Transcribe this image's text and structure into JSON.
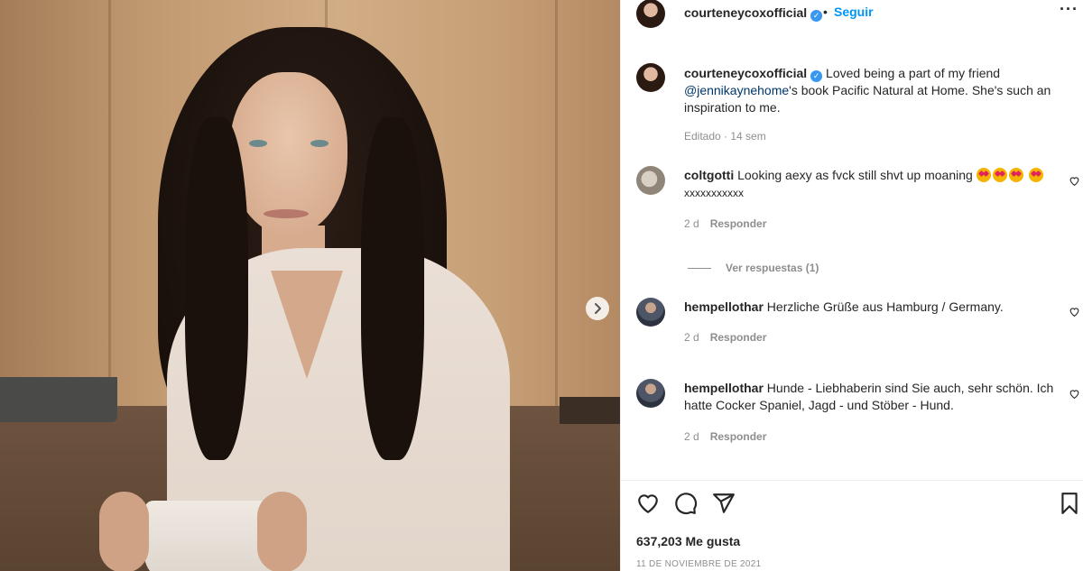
{
  "post": {
    "author": {
      "username": "courteneycoxofficial",
      "verified": true,
      "follow_label": "Seguir",
      "separator": "•"
    },
    "caption": {
      "username": "courteneycoxofficial",
      "text_before": "Loved being a part of my friend",
      "mention": "@jennikaynehome",
      "text_after": "'s book Pacific Natural at Home. She's such an inspiration to me.",
      "meta": "Editado · 14 sem"
    },
    "comments": [
      {
        "username": "coltgotti",
        "text": "Looking aexy as fvck still shvt up moaning",
        "text_tail": "xxxxxxxxxxx",
        "emojis": [
          "star-struck-emoji",
          "star-struck-emoji",
          "star-struck-emoji",
          "star-struck-emoji"
        ],
        "time": "2 d",
        "reply_label": "Responder",
        "view_replies": "Ver respuestas (1)"
      },
      {
        "username": "hempellothar",
        "text": "Herzliche Grüße aus Hamburg / Germany.",
        "time": "2 d",
        "reply_label": "Responder"
      },
      {
        "username": "hempellothar",
        "text": "Hunde - Liebhaberin sind Sie auch, sehr schön. Ich hatte Cocker Spaniel, Jagd - und Stöber - Hund.",
        "time": "2 d",
        "reply_label": "Responder"
      }
    ],
    "likes": "637,203 Me gusta",
    "date": "11 DE NOVIEMBRE DE 2021",
    "icons": {
      "more": "more-options-icon",
      "like": "heart-icon",
      "comment": "comment-icon",
      "share": "share-icon",
      "save": "bookmark-icon",
      "next": "chevron-right-icon"
    },
    "colors": {
      "link": "#00376b",
      "follow": "#0095f6",
      "muted": "#8e8e8e",
      "verified": "#3897f0"
    }
  }
}
